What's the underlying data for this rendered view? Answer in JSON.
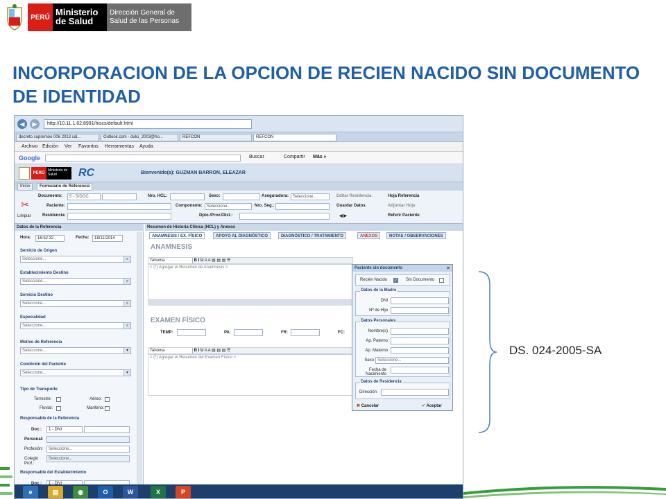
{
  "header": {
    "peru": "PERÚ",
    "ministry": "Ministerio de Salud",
    "direction": "Dirección General de Salud de las Personas"
  },
  "title": "INCORPORACION DE LA OPCION DE RECIEN NACIDO SIN DOCUMENTO DE IDENTIDAD",
  "annotation": "DS. 024-2005-SA",
  "browser": {
    "url": "http://10.11.1.62:8991/hiscs/default.html",
    "tabs": [
      "decreto supremoo 006 2013 sal...",
      "Outlook.com - dulci_2003@ho...",
      "REFCON",
      "REFCON"
    ],
    "menu": [
      "Archivo",
      "Edición",
      "Ver",
      "Favoritos",
      "Herramientas",
      "Ayuda"
    ],
    "google_label": "Google",
    "buscar": "Buscar",
    "compartir": "Compartir",
    "mas": "Más »"
  },
  "app": {
    "welcome": "Bienvenido(a): GUZMAN BARRON, ELEAZAR",
    "peru": "PERÚ",
    "ministry": "Ministerio de Salud",
    "rc_logo": "RC",
    "tabs": [
      "Inicio",
      "Formulario de Referencia"
    ],
    "form": {
      "documento_label": "Documento:",
      "documento_value": "5 - S/DOC.",
      "paciente_label": "Paciente:",
      "residencia_label": "Residencia:",
      "nro_hcl_label": "Nro. HCL:",
      "sexo_label": "Sexo:",
      "aseguradora_label": "Aseguradora:",
      "aseguradora_value": "Seleccione...",
      "componente_label": "Componente:",
      "componente_value": "Seleccione...",
      "nro_seg_label": "Nro. Seg.:",
      "dpto_label": "Dpto./Prov./Dist.:",
      "limpiar": "Limpiar",
      "editar_residencia": "Editar Residencia",
      "guardar_datos": "Guardar Datos",
      "hoja_referencia": "Hoja Referencia",
      "adjuntar_hoja": "Adjuntar Hoja",
      "referir_paciente": "Referir Paciente"
    },
    "sidebar": {
      "title": "Datos de la Referencia",
      "hora_label": "Hora:",
      "hora_value": "16:52:32",
      "fecha_label": "Fecha:",
      "fecha_value": "18/11/2014",
      "sections": [
        {
          "title": "Servicio de Origen",
          "value": "Seleccione..."
        },
        {
          "title": "Establecimiento Destino",
          "value": "Seleccione..."
        },
        {
          "title": "Servicio Destino",
          "value": "Seleccione..."
        },
        {
          "title": "Especialidad",
          "value": "Seleccione..."
        },
        {
          "title": "Motivo de Referencia",
          "value": "Seleccione..."
        },
        {
          "title": "Condición del Paciente",
          "value": "Seleccione..."
        }
      ],
      "transporte_title": "Tipo de Transporte",
      "terrestre": "Terrestre:",
      "aereo": "Aéreo:",
      "fluvial": "Fluvial:",
      "maritimo": "Marítimo:",
      "resp_ref_title": "Responsable de la Referencia",
      "doc_label": "Doc.:",
      "doc_value": "1 - DNI",
      "personal_label": "Personal:",
      "profesion_label": "Profesión:",
      "profesion_value": "Seleccione...",
      "colegio_label": "Colegio Prof.:",
      "colegio_value": "Seleccione...",
      "resp_est_title": "Responsable del Establecimiento",
      "doc2_value": "1 - DNI"
    },
    "main": {
      "header": "Resumen de Historia Clínica (HCL) y Anexos",
      "tabs": [
        "ANAMNESIS / EX. FÍSICO",
        "APOYO AL DIAGNÓSTICO",
        "DIAGNÓSTICO / TRATAMIENTO",
        "ANEXOS",
        "NOTAS / OBSERVACIONES"
      ],
      "anamnesis_title": "ANAMNESIS",
      "font": "Tahoma",
      "anamnesis_placeholder": "< (*) Agregar el Resumen de Anamnesis >",
      "examen_title": "EXAMEN FÍSICO",
      "temp": "TEMP:",
      "pa": "PA:",
      "fr": "FR:",
      "fc": "FC:",
      "examen_placeholder": "< (*) Agregar el Resumen del Examen Físico >"
    },
    "dialog": {
      "title": "Paciente sin documento",
      "recien_nacido": "Recién Nacido",
      "sin_documento": "Sin Documento",
      "madre_title": "Datos de la Madre",
      "dni": "DNI",
      "nro_hijo": "Nº de Hijo",
      "personales_title": "Datos Personales",
      "nombres": "Nombre(s)",
      "ap_paterno": "Ap. Paterno",
      "ap_materno": "Ap. Materno",
      "sexo": "Sexo",
      "sexo_value": "Seleccione...",
      "fecha_nac": "Fecha de Nacimiento",
      "residencia_title": "Datos de Residencia",
      "direccion": "Dirección",
      "cancelar": "Cancelar",
      "aceptar": "Aceptar"
    }
  },
  "taskbar": [
    "e",
    "▤",
    "◉",
    "O",
    "W",
    "X",
    "P"
  ],
  "colors": {
    "title": "#1f5fa8",
    "peru_red": "#d91e18",
    "green": "#3a9b3a"
  }
}
